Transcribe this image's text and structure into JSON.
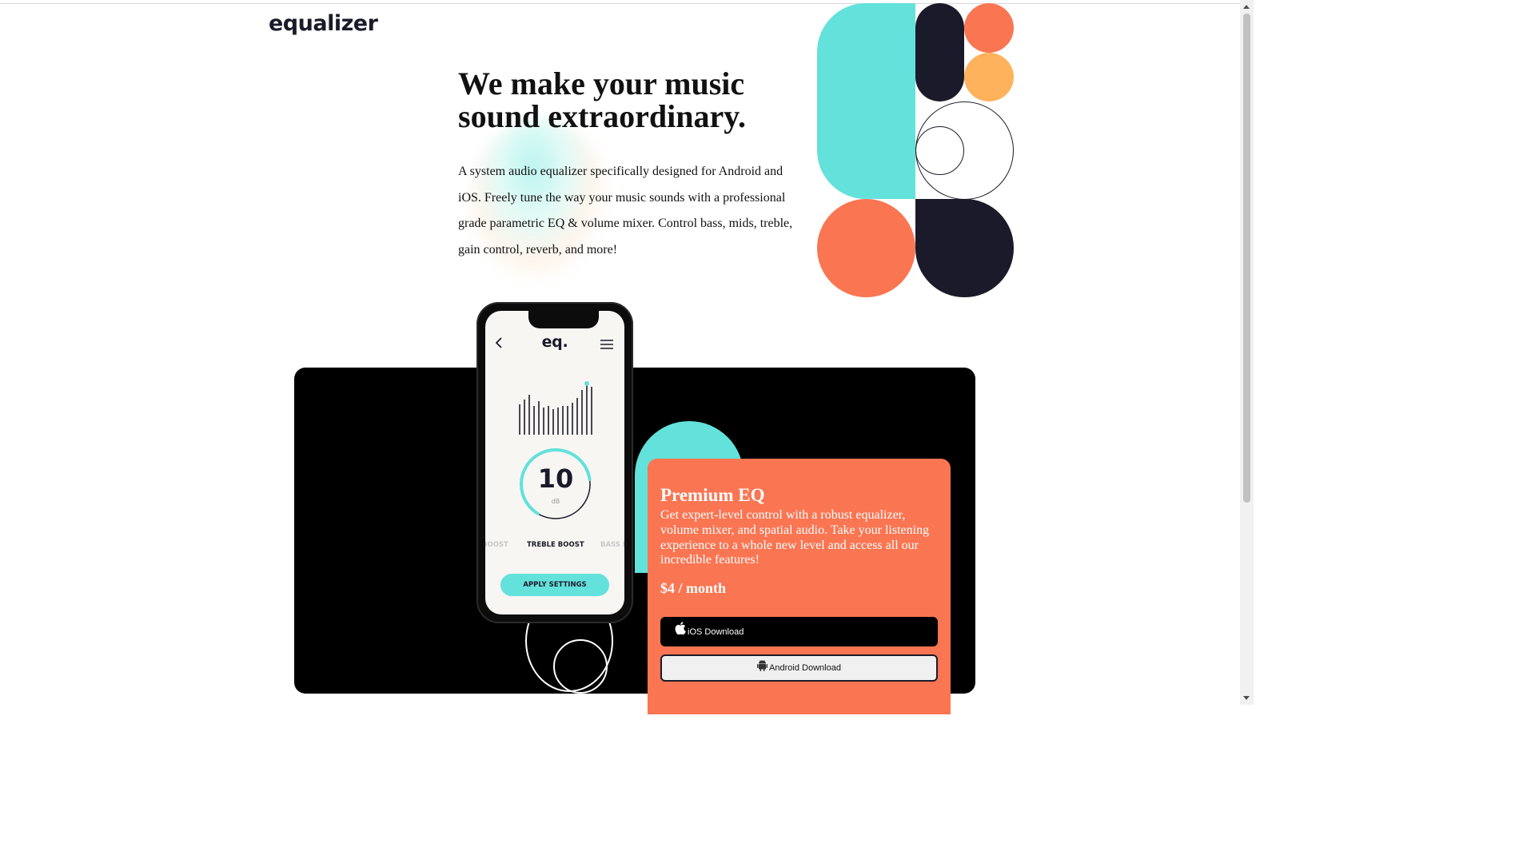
{
  "brand": {
    "logo": "equalizer"
  },
  "hero": {
    "headline": "We make your music sound extraordinary.",
    "intro": "A system audio equalizer specifically designed for Android and iOS. Freely tune the way your music sounds with a professional grade parametric EQ & volume mixer. Control bass, mids, treble, gain control, reverb, and more!"
  },
  "phone": {
    "app_logo": "eq.",
    "dial_value": "10",
    "dial_unit": "dB",
    "dial_level": 0.82,
    "modes": [
      "BOOST",
      "TREBLE BOOST",
      "BASS B"
    ],
    "apply_label": "APPLY SETTINGS",
    "icons": {
      "back": "chevron-left-icon",
      "menu": "hamburger-menu-icon"
    }
  },
  "premium": {
    "title": "Premium EQ",
    "description": "Get expert-level control with a robust equalizer, volume mixer, and spatial audio. Take your listening experience to a whole new level and access all our incredible features!",
    "price": "$4 / month",
    "ios_label": "iOS Download",
    "android_label": "Android Download",
    "icons": {
      "ios": "apple-icon",
      "android": "android-icon"
    }
  },
  "colors": {
    "teal": "#63e1db",
    "coral": "#fa7552",
    "orange": "#ffb25c",
    "navy": "#1b1a2a",
    "black": "#000000"
  }
}
